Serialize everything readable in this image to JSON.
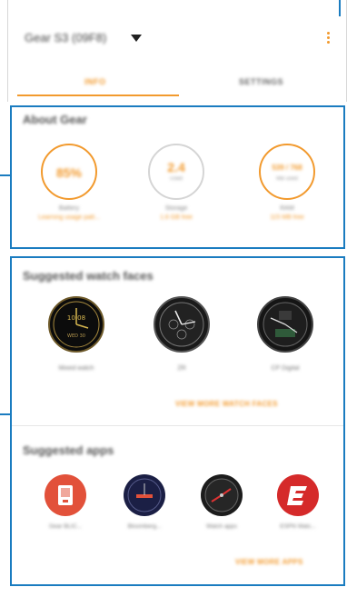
{
  "header": {
    "device_name": "Gear S3 (09F8)",
    "tabs": [
      {
        "label": "INFO",
        "active": true
      },
      {
        "label": "SETTINGS",
        "active": false
      }
    ]
  },
  "about": {
    "title": "About Gear",
    "stats": [
      {
        "value": "85%",
        "unit": "",
        "label": "Battery",
        "detail": "Learning usage patt..."
      },
      {
        "value": "2.4",
        "unit": "GB",
        "sub": "Used",
        "label": "Storage",
        "detail": "1.6 GB free"
      },
      {
        "value": "539 / 768",
        "unit": "",
        "sub": "MB used",
        "label": "RAM",
        "detail": "115 MB free"
      }
    ]
  },
  "watch_faces": {
    "title": "Suggested watch faces",
    "items": [
      {
        "name": "Mixed watch"
      },
      {
        "name": "ZR"
      },
      {
        "name": "CP Digital"
      }
    ],
    "more_label": "VIEW MORE WATCH FACES"
  },
  "apps": {
    "title": "Suggested apps",
    "items": [
      {
        "name": "Gear BLIC...",
        "color": "#e2513a"
      },
      {
        "name": "Bloomberg...",
        "color": "#1b1f45"
      },
      {
        "name": "Watch apps",
        "color": "#1c1c1c"
      },
      {
        "name": "ESPN Watc...",
        "color": "#d52a2a"
      }
    ],
    "more_label": "VIEW MORE APPS"
  },
  "colors": {
    "accent": "#f29a2e",
    "callout": "#1a7cc0"
  }
}
